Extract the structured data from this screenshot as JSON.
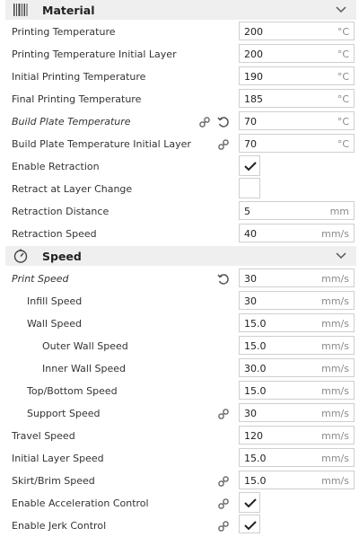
{
  "material": {
    "title": "Material",
    "icon": "spool-barcode-icon",
    "rows": [
      {
        "label": "Printing Temperature",
        "value": "200",
        "unit": "°C"
      },
      {
        "label": "Printing Temperature Initial Layer",
        "value": "200",
        "unit": "°C"
      },
      {
        "label": "Initial Printing Temperature",
        "value": "190",
        "unit": "°C"
      },
      {
        "label": "Final Printing Temperature",
        "value": "185",
        "unit": "°C"
      },
      {
        "label": "Build Plate Temperature",
        "value": "70",
        "unit": "°C"
      },
      {
        "label": "Build Plate Temperature Initial Layer",
        "value": "70",
        "unit": "°C"
      },
      {
        "label": "Enable Retraction",
        "checked": true
      },
      {
        "label": "Retract at Layer Change",
        "checked": false
      },
      {
        "label": "Retraction Distance",
        "value": "5",
        "unit": "mm"
      },
      {
        "label": "Retraction Speed",
        "value": "40",
        "unit": "mm/s"
      }
    ]
  },
  "speed": {
    "title": "Speed",
    "icon": "speedometer-icon",
    "rows": [
      {
        "label": "Print Speed",
        "value": "30",
        "unit": "mm/s"
      },
      {
        "label": "Infill Speed",
        "value": "30",
        "unit": "mm/s"
      },
      {
        "label": "Wall Speed",
        "value": "15.0",
        "unit": "mm/s"
      },
      {
        "label": "Outer Wall Speed",
        "value": "15.0",
        "unit": "mm/s"
      },
      {
        "label": "Inner Wall Speed",
        "value": "30.0",
        "unit": "mm/s"
      },
      {
        "label": "Top/Bottom Speed",
        "value": "15.0",
        "unit": "mm/s"
      },
      {
        "label": "Support Speed",
        "value": "30",
        "unit": "mm/s"
      },
      {
        "label": "Travel Speed",
        "value": "120",
        "unit": "mm/s"
      },
      {
        "label": "Initial Layer Speed",
        "value": "15.0",
        "unit": "mm/s"
      },
      {
        "label": "Skirt/Brim Speed",
        "value": "15.0",
        "unit": "mm/s"
      },
      {
        "label": "Enable Acceleration Control",
        "checked": true
      },
      {
        "label": "Enable Jerk Control",
        "checked": true
      }
    ]
  },
  "colors": {
    "header_bg": "#efefef",
    "border": "#cfcfcf",
    "unit_text": "#8a8a8a"
  }
}
